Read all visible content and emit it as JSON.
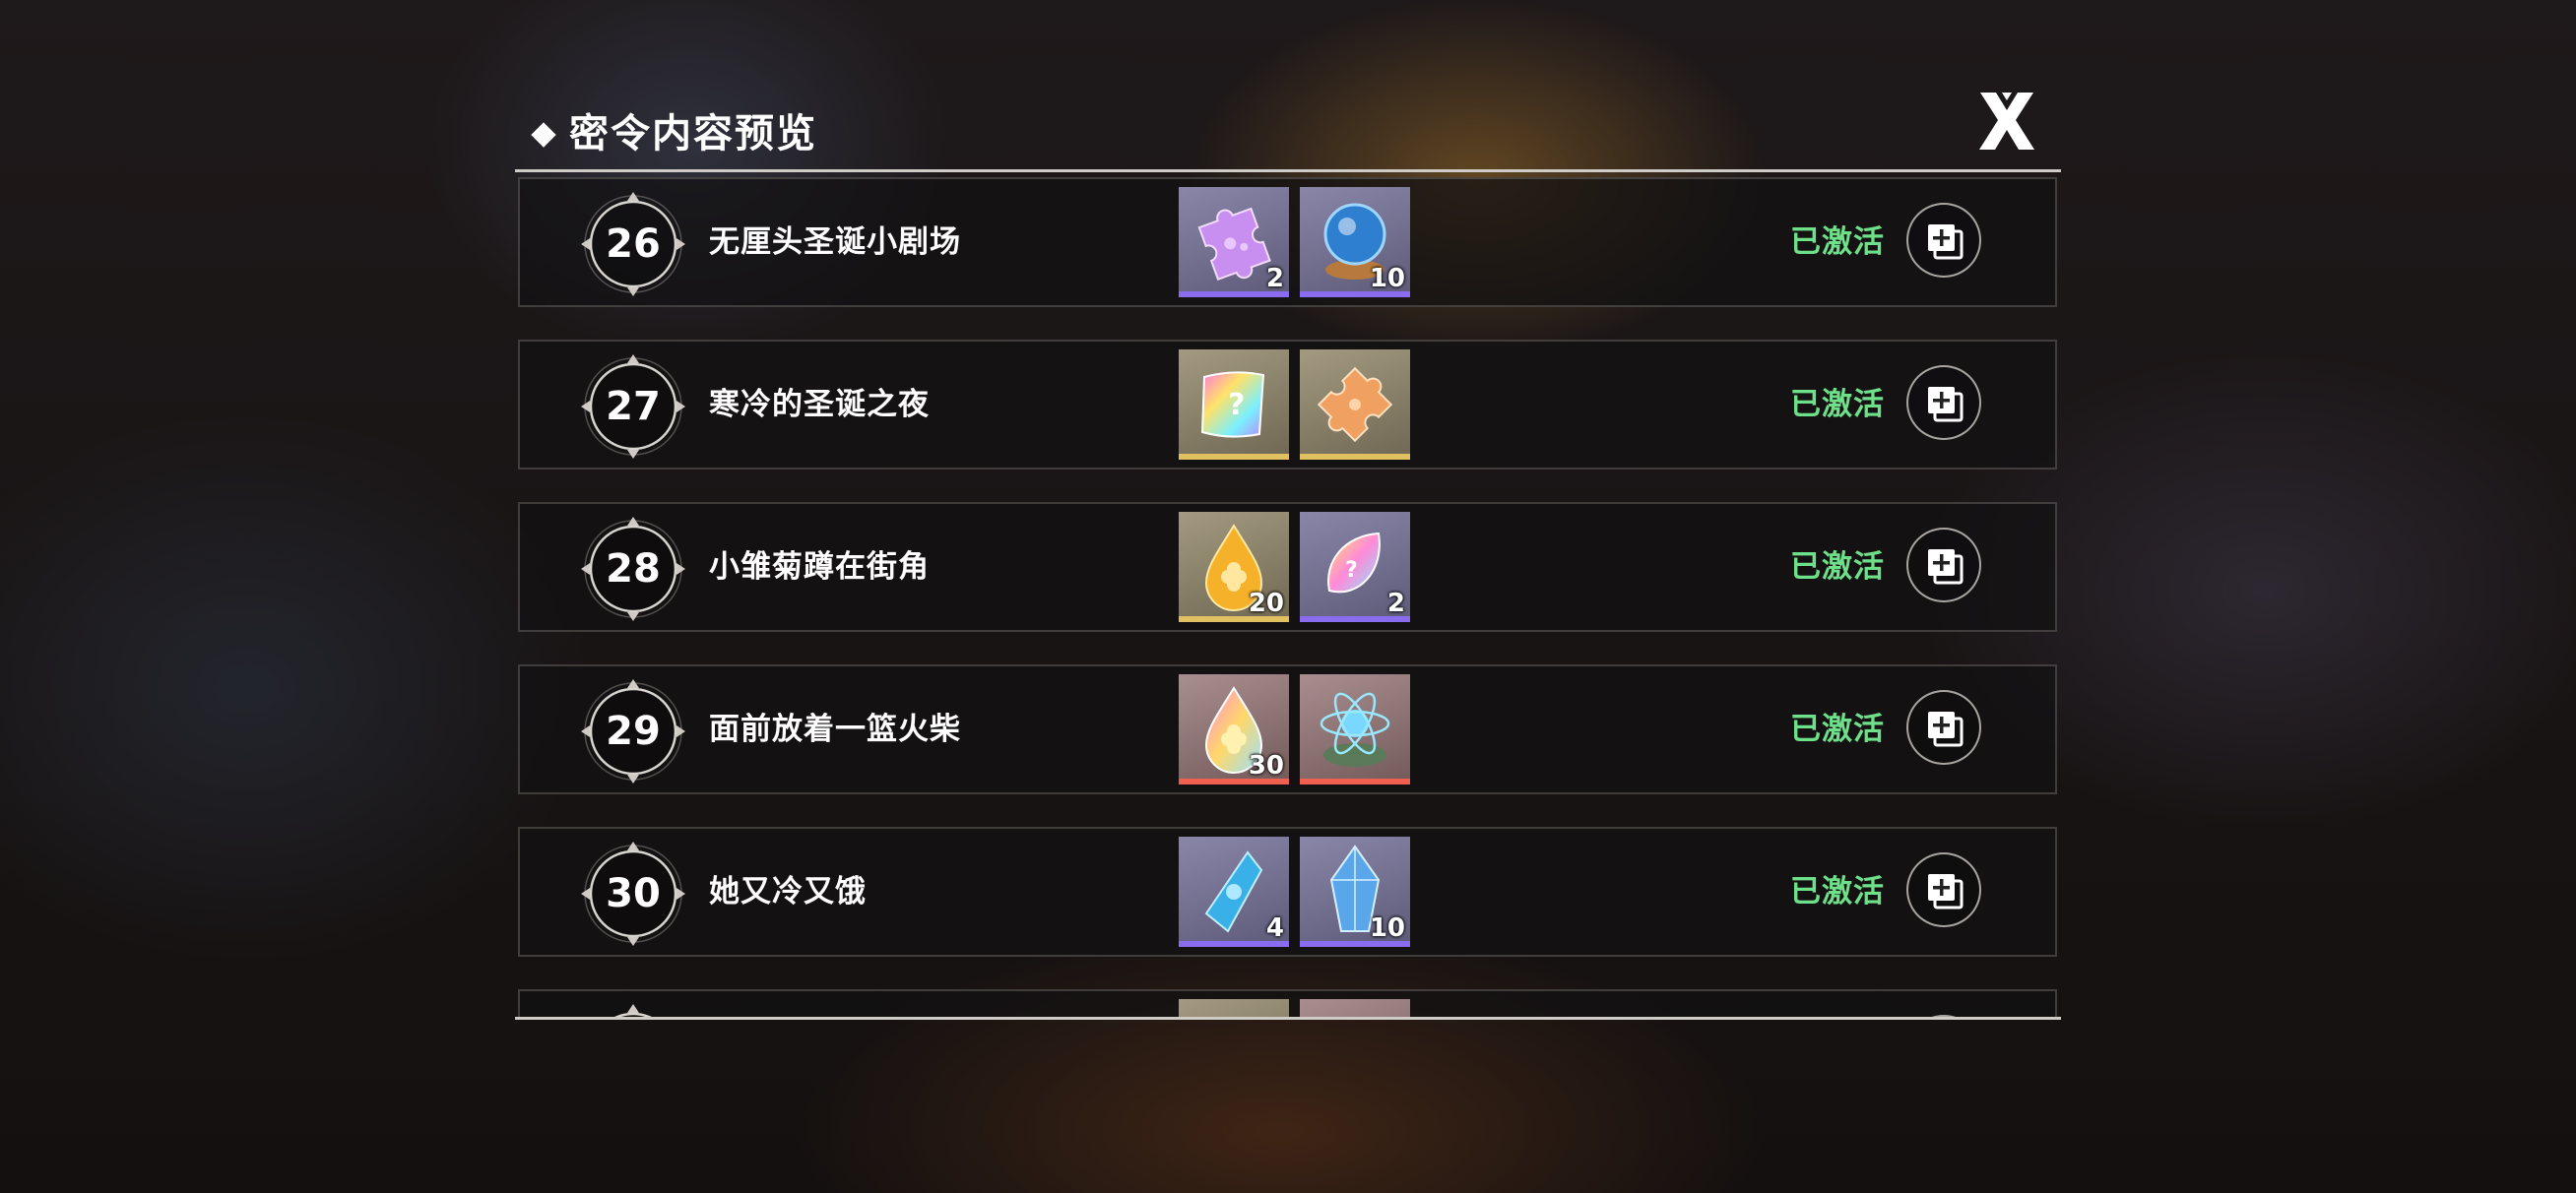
{
  "header": {
    "title": "密令内容预览"
  },
  "rows": [
    {
      "number": "26",
      "name": "无厘头圣诞小剧场",
      "status": "已激活",
      "items": [
        {
          "icon": "purple-puzzle-piece-icon",
          "count": "2",
          "rarity_color": "#8a6cf0"
        },
        {
          "icon": "crystal-ball-icon",
          "count": "10",
          "rarity_color": "#8a6cf0"
        }
      ]
    },
    {
      "number": "27",
      "name": "寒冷的圣诞之夜",
      "status": "已激活",
      "items": [
        {
          "icon": "rainbow-card-pack-icon",
          "count": "",
          "rarity_color": "#e0c060"
        },
        {
          "icon": "orange-puzzle-piece-icon",
          "count": "",
          "rarity_color": "#e0c060"
        }
      ]
    },
    {
      "number": "28",
      "name": "小雏菊蹲在街角",
      "status": "已激活",
      "items": [
        {
          "icon": "golden-clover-drop-icon",
          "count": "20",
          "rarity_color": "#e0c060"
        },
        {
          "icon": "rainbow-seed-icon",
          "count": "2",
          "rarity_color": "#8a6cf0"
        }
      ]
    },
    {
      "number": "29",
      "name": "面前放着一篮火柴",
      "status": "已激活",
      "items": [
        {
          "icon": "rainbow-clover-drop-icon",
          "count": "30",
          "rarity_color": "#f06050"
        },
        {
          "icon": "atom-orb-icon",
          "count": "",
          "rarity_color": "#f06050"
        }
      ]
    },
    {
      "number": "30",
      "name": "她又冷又饿",
      "status": "已激活",
      "items": [
        {
          "icon": "blue-crystal-shard-icon",
          "count": "4",
          "rarity_color": "#8a6cf0"
        },
        {
          "icon": "blue-crystal-cluster-icon",
          "count": "10",
          "rarity_color": "#8a6cf0"
        }
      ]
    }
  ]
}
